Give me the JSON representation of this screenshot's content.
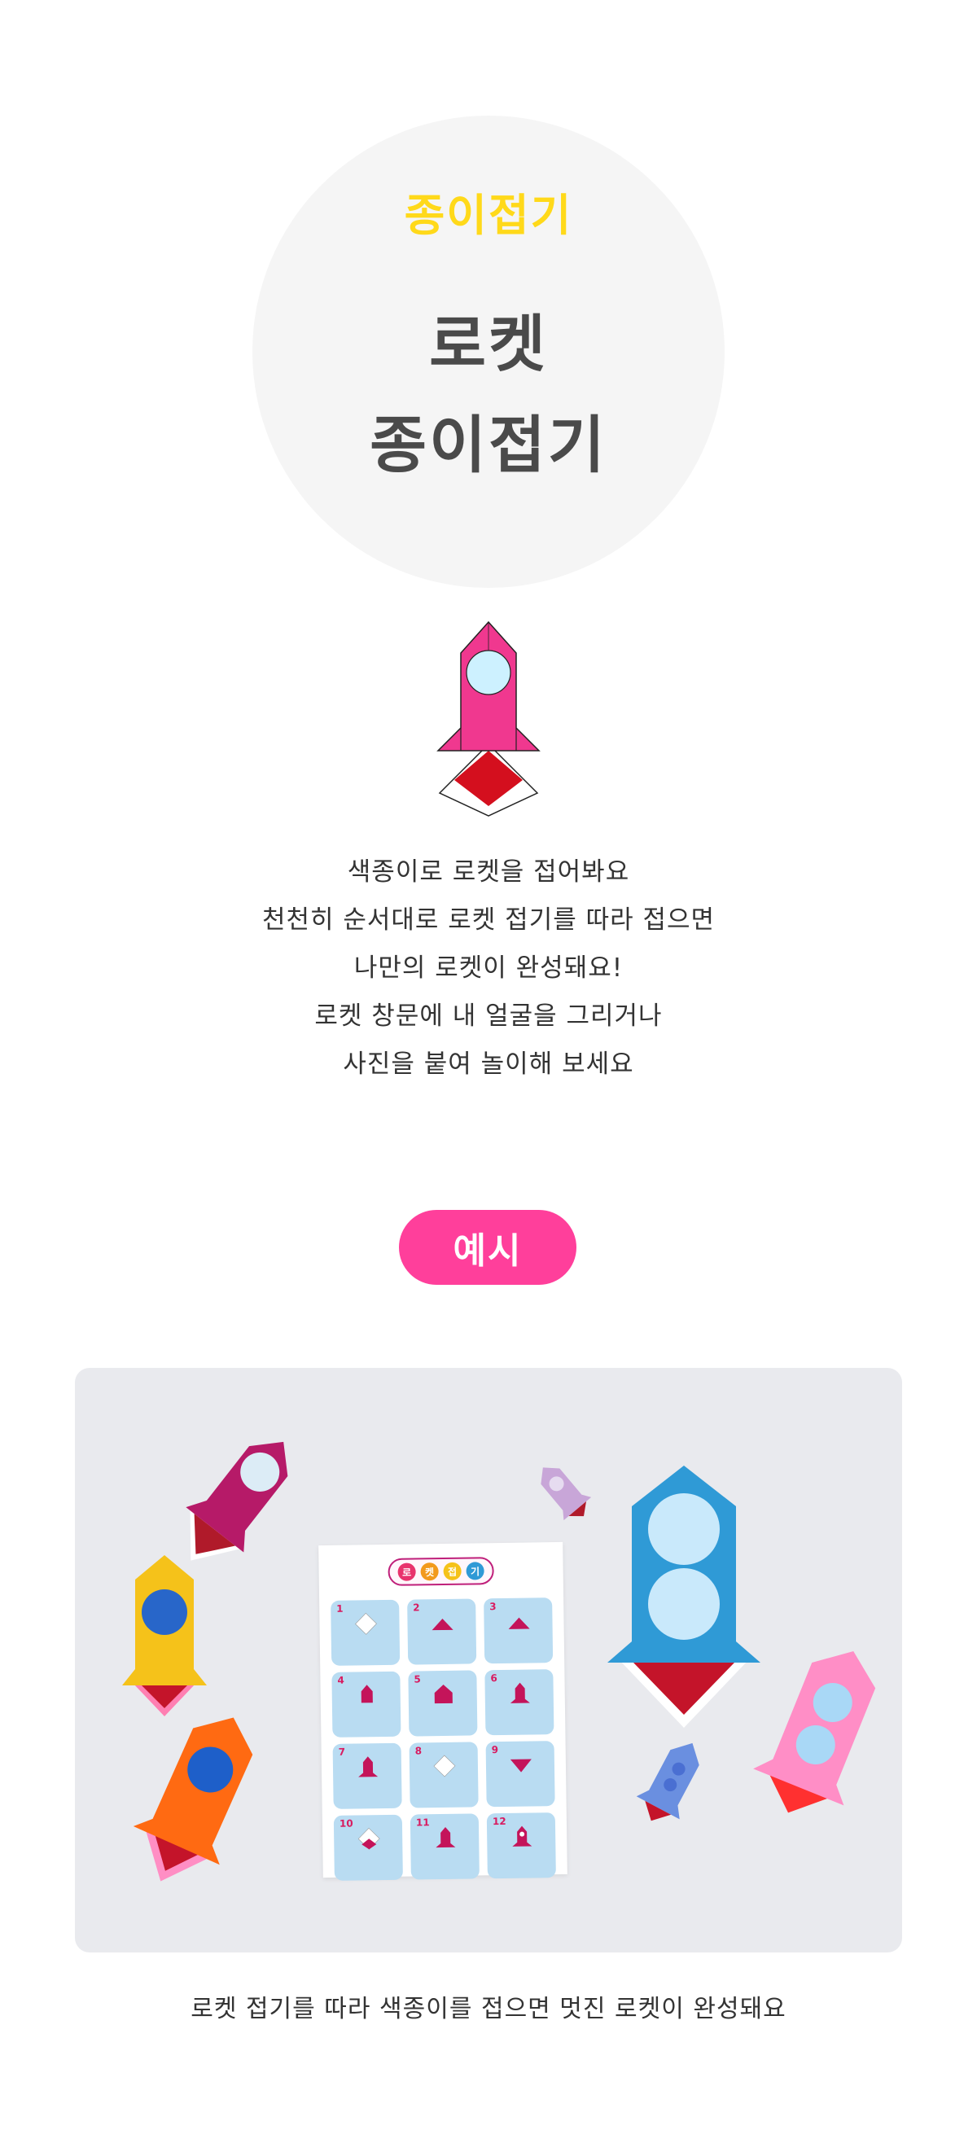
{
  "hero": {
    "tag": "종이접기",
    "title_line1": "로켓",
    "title_line2": "종이접기"
  },
  "intro": {
    "lines": [
      "색종이로 로켓을 접어봐요",
      "천천히 순서대로 로켓 접기를 따라 접으면",
      "나만의 로켓이 완성돼요!",
      "로켓 창문에 내 얼굴을 그리거나",
      "사진을 붙여 놀이해 보세요"
    ]
  },
  "example_badge": "예시",
  "photo": {
    "sheet_title": [
      "로",
      "켓",
      "접",
      "기"
    ],
    "steps": [
      {
        "num": "1",
        "icon": "diamond-paper-icon"
      },
      {
        "num": "2",
        "icon": "triangle-fold-icon"
      },
      {
        "num": "3",
        "icon": "triangle-fold-icon"
      },
      {
        "num": "4",
        "icon": "rocket-shape-icon"
      },
      {
        "num": "5",
        "icon": "house-fold-icon"
      },
      {
        "num": "6",
        "icon": "rocket-shape-icon"
      },
      {
        "num": "7",
        "icon": "rocket-shape-icon"
      },
      {
        "num": "8",
        "icon": "diamond-paper-icon"
      },
      {
        "num": "9",
        "icon": "triangle-fold-icon"
      },
      {
        "num": "10",
        "icon": "diamond-paper-icon"
      },
      {
        "num": "11",
        "icon": "rocket-shape-icon"
      },
      {
        "num": "12",
        "icon": "rocket-shape-icon"
      }
    ]
  },
  "caption": "로켓 접기를 따라 색종이를 접으면 멋진 로켓이 완성돼요",
  "colors": {
    "tag_yellow": "#ffd91a",
    "title_gray": "#4a4a4a",
    "badge_pink": "#ff3f9b",
    "rocket_pink": "#f0388f",
    "rocket_window": "#cdf1ff",
    "fold_red": "#d40f1e"
  }
}
